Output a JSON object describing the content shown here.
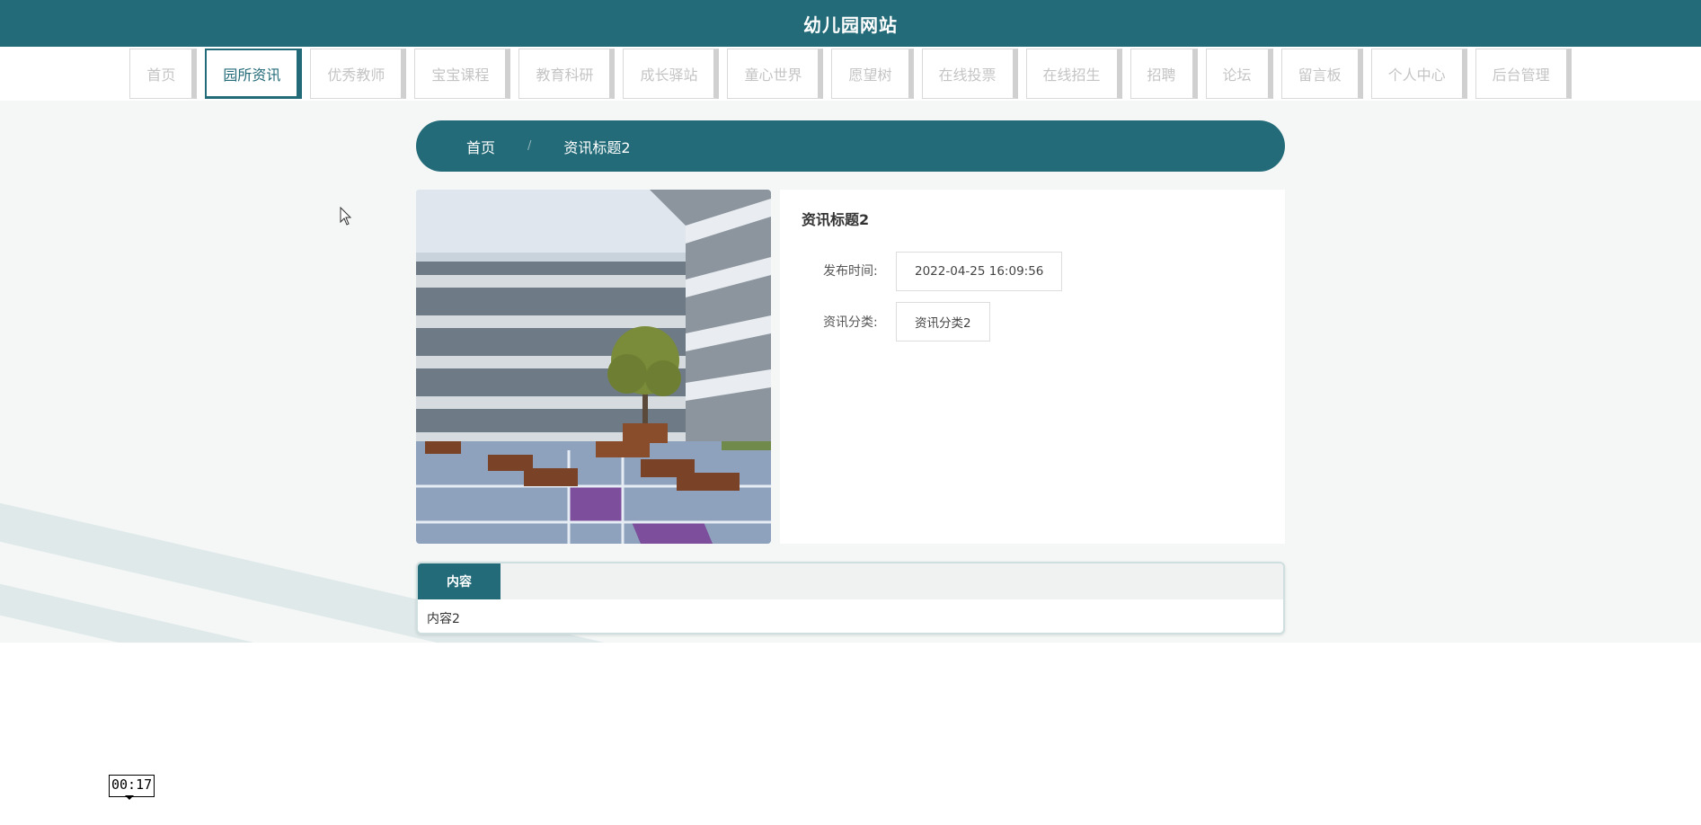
{
  "site": {
    "title": "幼儿园网站"
  },
  "nav": {
    "items": [
      {
        "label": "首页"
      },
      {
        "label": "园所资讯",
        "active": true
      },
      {
        "label": "优秀教师"
      },
      {
        "label": "宝宝课程"
      },
      {
        "label": "教育科研"
      },
      {
        "label": "成长驿站"
      },
      {
        "label": "童心世界"
      },
      {
        "label": "愿望树"
      },
      {
        "label": "在线投票"
      },
      {
        "label": "在线招生"
      },
      {
        "label": "招聘"
      },
      {
        "label": "论坛"
      },
      {
        "label": "留言板"
      },
      {
        "label": "个人中心"
      },
      {
        "label": "后台管理"
      }
    ]
  },
  "breadcrumb": {
    "home": "首页",
    "separator": "/",
    "current": "资讯标题2"
  },
  "article": {
    "title": "资讯标题2",
    "publish_label": "发布时间:",
    "publish_value": "2022-04-25 16:09:56",
    "category_label": "资讯分类:",
    "category_value": "资讯分类2"
  },
  "tabs": {
    "active_label": "内容",
    "content": "内容2"
  },
  "overlay": {
    "timer": "00:17"
  },
  "colors": {
    "primary": "#236b78",
    "page_bg": "#f4f7f6"
  }
}
